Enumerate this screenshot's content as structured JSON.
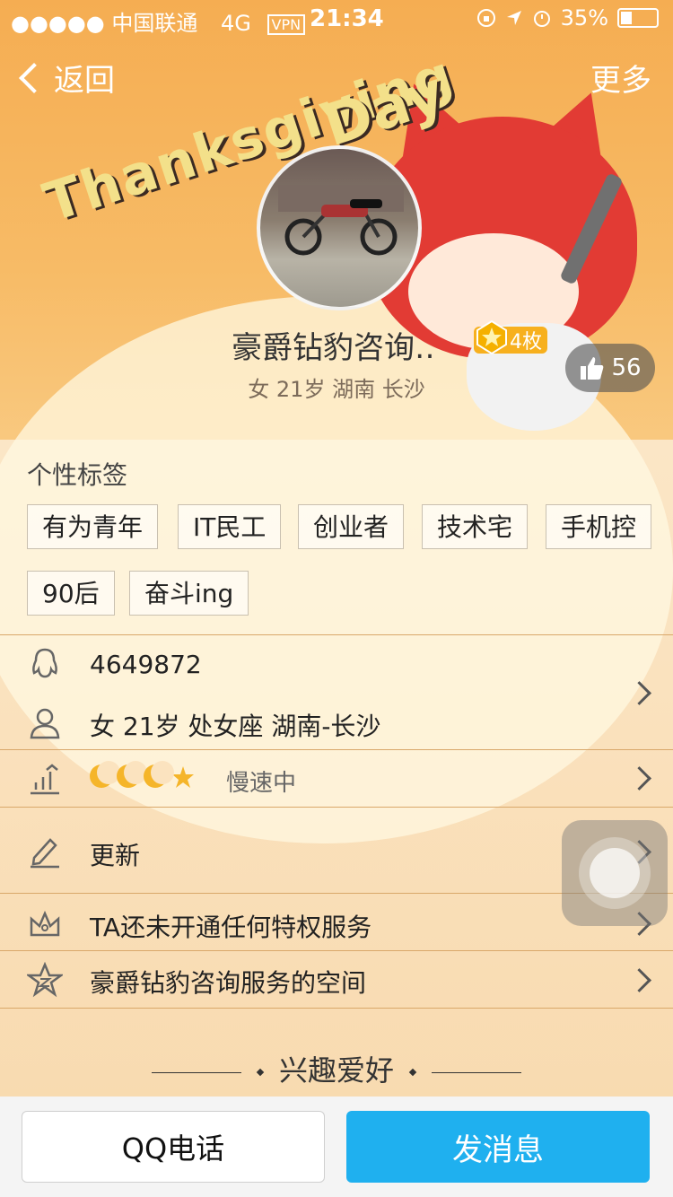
{
  "status_bar": {
    "signal": "●●●●●",
    "carrier": "中国联通",
    "network": "4G",
    "vpn": "VPN",
    "time": "21:34",
    "battery": "35%",
    "battery_level": 0.35
  },
  "nav": {
    "back_label": "返回",
    "more_label": "更多"
  },
  "cover_text": {
    "line1": "Thanksgiving",
    "line2": "Day"
  },
  "profile": {
    "name": "豪爵钻豹咨询…",
    "medal_count": "4枚",
    "info": "女  21岁  湖南 长沙",
    "likes": "56"
  },
  "tags_section": {
    "title": "个性标签",
    "tags": [
      "有为青年",
      "IT民工",
      "创业者",
      "技术宅",
      "手机控",
      "90后",
      "奋斗ing"
    ]
  },
  "rows": {
    "qq_number": "4649872",
    "details": "女 21岁 处女座 湖南-长沙",
    "level_status": "慢速中",
    "update_label": "更新",
    "privilege": "TA还未开通任何特权服务",
    "space": "豪爵钻豹咨询服务的空间"
  },
  "interest_title": "兴趣爱好",
  "bottom": {
    "call_label": "QQ电话",
    "message_label": "发消息"
  },
  "colors": {
    "accent_blue": "#1fb0ef",
    "medal_gold": "#f7b01e",
    "header_orange": "#f5ad52"
  }
}
